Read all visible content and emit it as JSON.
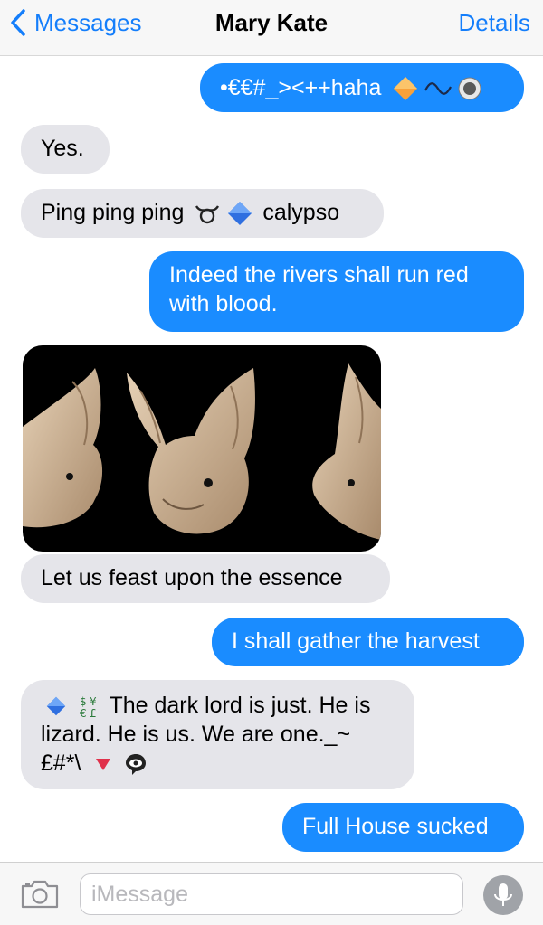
{
  "nav": {
    "back_label": "Messages",
    "title": "Mary Kate",
    "details_label": "Details"
  },
  "messages": [
    {
      "direction": "outgoing",
      "text": "•€€#_><++haha"
    },
    {
      "direction": "incoming",
      "text": "Yes."
    },
    {
      "direction": "incoming",
      "text_before": "Ping ping ping",
      "text_after": "calypso"
    },
    {
      "direction": "outgoing",
      "text_line1": "Indeed the rivers shall run red",
      "text_line2": "with blood."
    },
    {
      "direction": "incoming",
      "type": "image"
    },
    {
      "direction": "incoming",
      "text": "Let us feast upon the essence"
    },
    {
      "direction": "outgoing",
      "text": "I shall gather the harvest"
    },
    {
      "direction": "incoming",
      "text_line1": "The dark lord is just. He is",
      "text_line2": "lizard. He is us. We are one._~",
      "text_line3": "£#*\\"
    },
    {
      "direction": "outgoing",
      "text": "Full House sucked"
    }
  ],
  "input": {
    "placeholder": "iMessage"
  },
  "colors": {
    "accent": "#147efb",
    "outgoing_bubble": "#1a8cff",
    "incoming_bubble": "#e5e5ea"
  },
  "icons": [
    "chevron-left-icon",
    "camera-icon",
    "microphone-icon",
    "orange-diamond-icon",
    "curly-loop-icon",
    "radio-button-icon",
    "taurus-icon",
    "blue-diamond-icon",
    "currency-exchange-icon",
    "red-triangle-icon",
    "eye-speech-bubble-icon"
  ]
}
